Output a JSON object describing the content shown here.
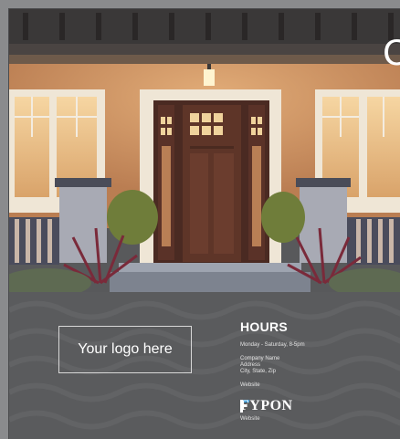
{
  "overlay": {
    "partial_letter": "C"
  },
  "logo_placeholder": "Your logo here",
  "hours": {
    "title": "HOURS",
    "schedule": "Monday - Saturday, 8-5pm"
  },
  "company": {
    "name": "Company Name",
    "address": "Address",
    "city": "City, State, Zip",
    "website": "Website"
  },
  "brand": {
    "logo_text": "FYPON",
    "website": "Website"
  },
  "colors": {
    "panel_bg": "#5a5b5d",
    "frame": "#8a8b8d",
    "brand_accent": "#2a8fd0",
    "text": "#ffffff"
  }
}
